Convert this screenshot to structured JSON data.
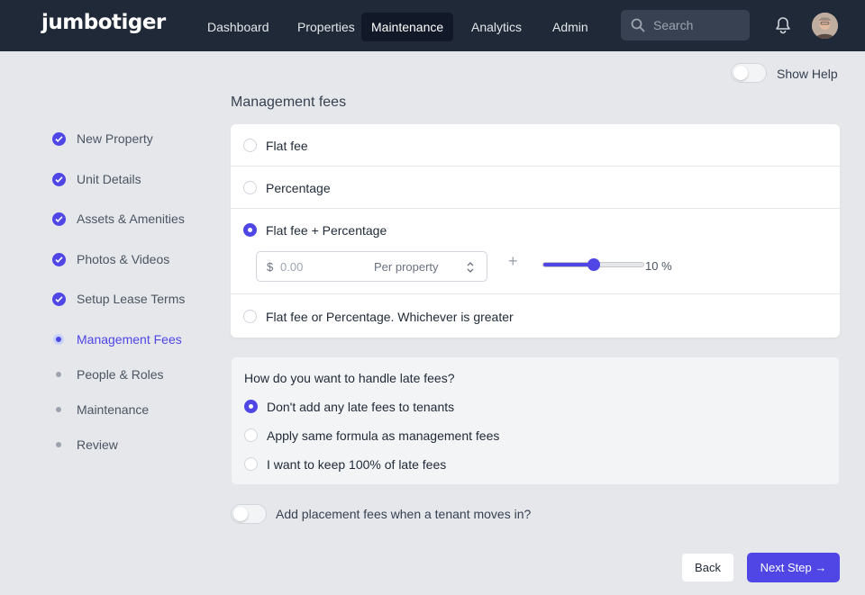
{
  "app": {
    "logo": "jumbotiger"
  },
  "nav": {
    "items": [
      {
        "label": "Dashboard"
      },
      {
        "label": "Properties"
      },
      {
        "label": "Maintenance"
      },
      {
        "label": "Analytics"
      },
      {
        "label": "Admin"
      }
    ]
  },
  "search": {
    "placeholder": "Search"
  },
  "help": {
    "label": "Show Help",
    "on": false
  },
  "steps": [
    {
      "label": "New Property",
      "state": "complete"
    },
    {
      "label": "Unit Details",
      "state": "complete"
    },
    {
      "label": "Assets & Amenities",
      "state": "complete"
    },
    {
      "label": "Photos & Videos",
      "state": "complete"
    },
    {
      "label": "Setup Lease Terms",
      "state": "complete"
    },
    {
      "label": "Management Fees",
      "state": "current"
    },
    {
      "label": "People & Roles",
      "state": "upcoming"
    },
    {
      "label": "Maintenance",
      "state": "upcoming"
    },
    {
      "label": "Review",
      "state": "upcoming"
    }
  ],
  "fees": {
    "title": "Management fees",
    "options": [
      {
        "label": "Flat fee",
        "selected": false
      },
      {
        "label": "Percentage",
        "selected": false
      },
      {
        "label": "Flat fee + Percentage",
        "selected": true
      },
      {
        "label": "Flat fee or Percentage. Whichever is greater",
        "selected": false
      }
    ],
    "currency": "$",
    "amount_placeholder": "0.00",
    "per_option": "Per property",
    "plus": "+",
    "percent_value": 10,
    "percent_label": "10 %"
  },
  "late": {
    "question": "How do you want to handle late fees?",
    "options": [
      {
        "label": "Don't add any late fees to tenants",
        "selected": true
      },
      {
        "label": "Apply same formula as management fees",
        "selected": false
      },
      {
        "label": "I want to keep 100% of late fees",
        "selected": false
      }
    ]
  },
  "placement": {
    "label": "Add placement fees when a tenant moves in?",
    "on": false
  },
  "actions": {
    "back": "Back",
    "next": "Next Step →"
  },
  "colors": {
    "accent": "#4f46e5",
    "topbar": "#1f2937"
  }
}
